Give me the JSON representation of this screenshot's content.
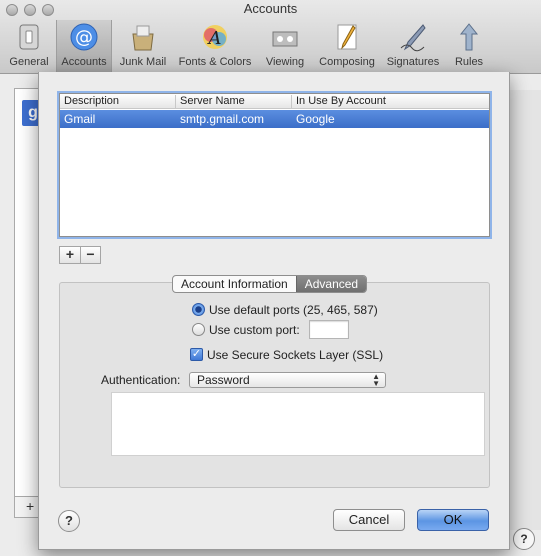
{
  "window": {
    "title": "Accounts"
  },
  "toolbar": {
    "items": [
      {
        "label": "General",
        "icon": "general-switch-icon"
      },
      {
        "label": "Accounts",
        "icon": "at-sign-icon",
        "selected": true
      },
      {
        "label": "Junk Mail",
        "icon": "junk-mail-icon"
      },
      {
        "label": "Fonts & Colors",
        "icon": "fonts-colors-icon"
      },
      {
        "label": "Viewing",
        "icon": "viewing-icon"
      },
      {
        "label": "Composing",
        "icon": "composing-pencil-icon"
      },
      {
        "label": "Signatures",
        "icon": "signatures-pen-icon"
      },
      {
        "label": "Rules",
        "icon": "rules-icon"
      }
    ]
  },
  "smtp_table": {
    "columns": [
      "Description",
      "Server Name",
      "In Use By Account"
    ],
    "rows": [
      {
        "description": "Gmail",
        "server": "smtp.gmail.com",
        "account": "Google",
        "selected": true
      }
    ]
  },
  "list_buttons": {
    "add": "+",
    "remove": "−"
  },
  "tabs": [
    {
      "label": "Account Information",
      "active": false
    },
    {
      "label": "Advanced",
      "active": true
    }
  ],
  "advanced": {
    "default_ports_label": "Use default ports (25, 465, 587)",
    "default_ports_selected": true,
    "custom_port_label": "Use custom port:",
    "custom_port_value": "",
    "ssl_label": "Use Secure Sockets Layer (SSL)",
    "ssl_checked": true,
    "auth_label": "Authentication:",
    "auth_value": "Password"
  },
  "footer": {
    "help": "?",
    "cancel": "Cancel",
    "ok": "OK"
  },
  "background": {
    "add": "+",
    "help": "?",
    "g_icon": "g"
  },
  "colors": {
    "accent": "#3b6ec8",
    "selection": "#4a7fd6"
  }
}
